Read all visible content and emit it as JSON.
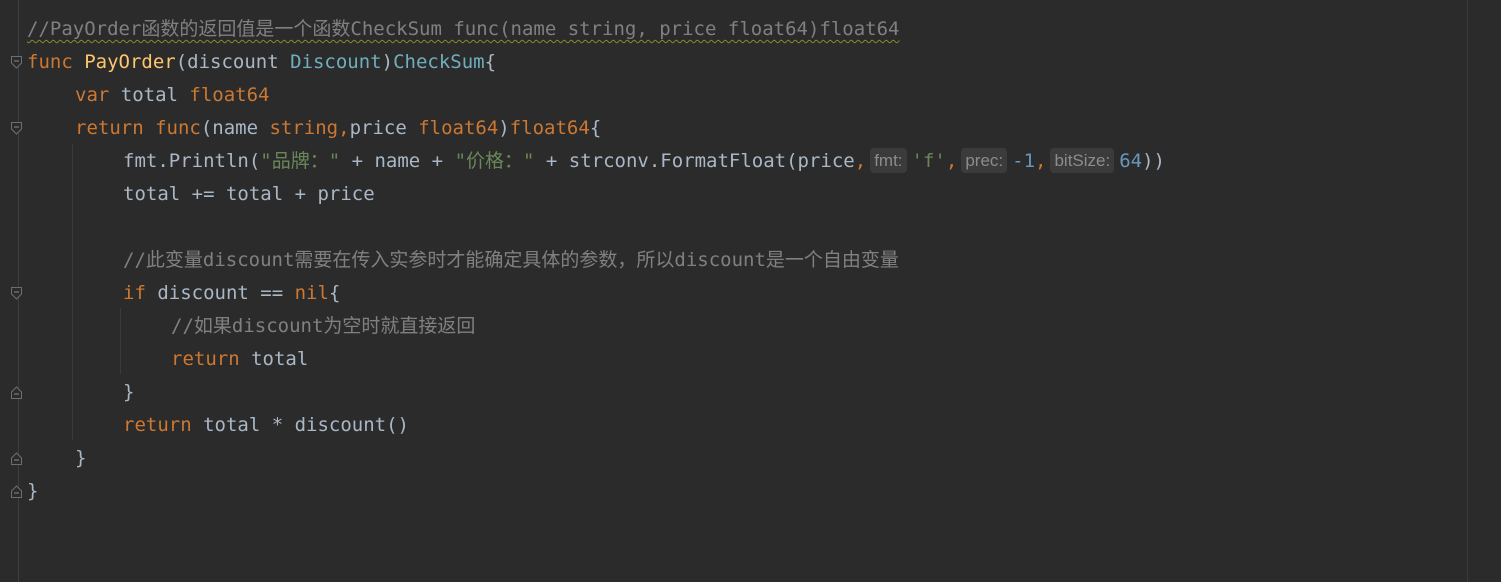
{
  "editor": {
    "lines": [
      {
        "indent": 0,
        "tokens": [
          {
            "t": "//PayOrder函数的返回值是一个函数CheckSum func(name string, price float64)float64",
            "c": "cmt wavy"
          }
        ]
      },
      {
        "indent": 0,
        "tokens": [
          {
            "t": "func ",
            "c": "kw"
          },
          {
            "t": "PayOrder",
            "c": "fn"
          },
          {
            "t": "(discount ",
            "c": "id"
          },
          {
            "t": "Discount",
            "c": "typ"
          },
          {
            "t": ")",
            "c": "id"
          },
          {
            "t": "CheckSum",
            "c": "typ"
          },
          {
            "t": "{",
            "c": "id"
          }
        ]
      },
      {
        "indent": 1,
        "tokens": [
          {
            "t": "var ",
            "c": "kw"
          },
          {
            "t": "total ",
            "c": "id"
          },
          {
            "t": "float64",
            "c": "kw"
          }
        ]
      },
      {
        "indent": 1,
        "tokens": [
          {
            "t": "return ",
            "c": "kw"
          },
          {
            "t": "func",
            "c": "kw"
          },
          {
            "t": "(name ",
            "c": "id"
          },
          {
            "t": "string,",
            "c": "kw"
          },
          {
            "t": "price ",
            "c": "id"
          },
          {
            "t": "float64",
            "c": "kw"
          },
          {
            "t": ")",
            "c": "id"
          },
          {
            "t": "float64",
            "c": "kw"
          },
          {
            "t": "{",
            "c": "id"
          }
        ]
      },
      {
        "indent": 2,
        "tokens": [
          {
            "t": "fmt.Println(",
            "c": "id"
          },
          {
            "t": "\"品牌：\"",
            "c": "str"
          },
          {
            "t": " + name + ",
            "c": "id"
          },
          {
            "t": "\"价格：\"",
            "c": "str"
          },
          {
            "t": " + strconv.FormatFloat(price",
            "c": "id"
          },
          {
            "t": ",",
            "c": "kw"
          },
          {
            "hint": "fmt:"
          },
          {
            "t": "'f'",
            "c": "str"
          },
          {
            "t": ",",
            "c": "kw"
          },
          {
            "hint": "prec:"
          },
          {
            "t": "-1",
            "c": "num"
          },
          {
            "t": ",",
            "c": "kw"
          },
          {
            "hint": "bitSize:"
          },
          {
            "t": "64",
            "c": "num"
          },
          {
            "t": "))",
            "c": "id"
          }
        ]
      },
      {
        "indent": 2,
        "tokens": [
          {
            "t": "total += total + price",
            "c": "id"
          }
        ]
      },
      {
        "indent": 2,
        "tokens": []
      },
      {
        "indent": 2,
        "tokens": [
          {
            "t": "//此变量discount需要在传入实参时才能确定具体的参数，所以discount是一个自由变量",
            "c": "cmt"
          }
        ]
      },
      {
        "indent": 2,
        "tokens": [
          {
            "t": "if ",
            "c": "kw"
          },
          {
            "t": "discount == ",
            "c": "id"
          },
          {
            "t": "nil",
            "c": "kw"
          },
          {
            "t": "{",
            "c": "id"
          }
        ]
      },
      {
        "indent": 3,
        "tokens": [
          {
            "t": "//如果discount为空时就直接返回",
            "c": "cmt"
          }
        ]
      },
      {
        "indent": 3,
        "tokens": [
          {
            "t": "return ",
            "c": "kw"
          },
          {
            "t": "total",
            "c": "id"
          }
        ]
      },
      {
        "indent": 2,
        "tokens": [
          {
            "t": "}",
            "c": "id"
          }
        ]
      },
      {
        "indent": 2,
        "tokens": [
          {
            "t": "return ",
            "c": "kw"
          },
          {
            "t": "total * discount()",
            "c": "id"
          }
        ]
      },
      {
        "indent": 1,
        "tokens": [
          {
            "t": "}",
            "c": "id"
          }
        ]
      },
      {
        "indent": 0,
        "tokens": [
          {
            "t": "}",
            "c": "id"
          }
        ]
      }
    ],
    "folds": [
      {
        "line": 1,
        "type": "open"
      },
      {
        "line": 3,
        "type": "open"
      },
      {
        "line": 8,
        "type": "open"
      },
      {
        "line": 11,
        "type": "close"
      },
      {
        "line": 13,
        "type": "close"
      },
      {
        "line": 14,
        "type": "close"
      }
    ]
  },
  "colors": {
    "background": "#2b2b2b",
    "keyword": "#cc7832",
    "function": "#ffc66d",
    "identifier": "#a9b7c6",
    "type": "#6fafbd",
    "string": "#6a8759",
    "number": "#6897bb",
    "comment": "#808080"
  }
}
